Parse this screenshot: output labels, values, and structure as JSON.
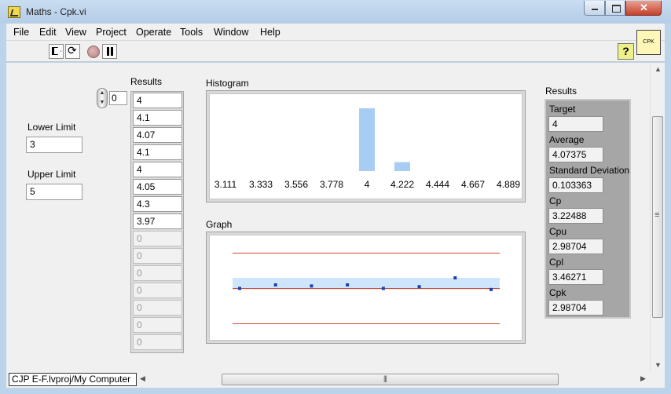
{
  "window": {
    "title": "Maths - Cpk.vi",
    "controls": [
      "minimize",
      "maximize",
      "close"
    ]
  },
  "menu": [
    {
      "label": "File"
    },
    {
      "label": "Edit"
    },
    {
      "label": "View"
    },
    {
      "label": "Project"
    },
    {
      "label": "Operate"
    },
    {
      "label": "Tools"
    },
    {
      "label": "Window"
    },
    {
      "label": "Help"
    }
  ],
  "toolbar": {
    "buttons": [
      "run-icon",
      "run-continuously-icon",
      "abort-icon",
      "pause-icon"
    ],
    "help_icon": "?",
    "vi_icon_text": "CPK"
  },
  "front_panel": {
    "lower_limit": {
      "label": "Lower Limit",
      "value": "3"
    },
    "upper_limit": {
      "label": "Upper Limit",
      "value": "5"
    },
    "results_array": {
      "label": "Results",
      "index": "0",
      "values": [
        "4",
        "4.1",
        "4.07",
        "4.1",
        "4",
        "4.05",
        "4.3",
        "3.97",
        "0",
        "0",
        "0",
        "0",
        "0",
        "0",
        "0"
      ]
    },
    "histogram": {
      "label": "Histogram"
    },
    "graph": {
      "label": "Graph"
    },
    "stats": {
      "title": "Results",
      "target": {
        "label": "Target",
        "value": "4"
      },
      "average": {
        "label": "Average",
        "value": "4.07375"
      },
      "std_dev": {
        "label": "Standard Deviation",
        "value": "0.103363"
      },
      "cp": {
        "label": "Cp",
        "value": "3.22488"
      },
      "cpu": {
        "label": "Cpu",
        "value": "2.98704"
      },
      "cpl": {
        "label": "Cpl",
        "value": "3.46271"
      },
      "cpk": {
        "label": "Cpk",
        "value": "2.98704"
      }
    }
  },
  "status": {
    "project_path": "CJP E-F.lvproj/My Computer"
  },
  "colors": {
    "bar": "#a7cdf5",
    "band": "#cfe5fb",
    "limit_line": "#d2452a",
    "point": "#1a3fb0"
  },
  "chart_data": [
    {
      "type": "bar",
      "categories": [
        "3.111",
        "3.333",
        "3.556",
        "3.778",
        "4",
        "4.222",
        "4.444",
        "4.667",
        "4.889"
      ],
      "values": [
        0,
        0,
        0,
        0,
        7,
        1,
        0,
        0,
        0
      ],
      "grid": false
    },
    {
      "type": "scatter",
      "series": [
        {
          "values": [
            4,
            4.1,
            4.07,
            4.1,
            4,
            4.05,
            4.3,
            3.97
          ]
        }
      ],
      "x": [
        0,
        1,
        2,
        3,
        4,
        5,
        6,
        7
      ],
      "reference_lines": [
        3,
        4,
        5
      ],
      "band": [
        3.97,
        4.3
      ],
      "ylim": [
        2.5,
        5.5
      ],
      "grid": false
    }
  ]
}
